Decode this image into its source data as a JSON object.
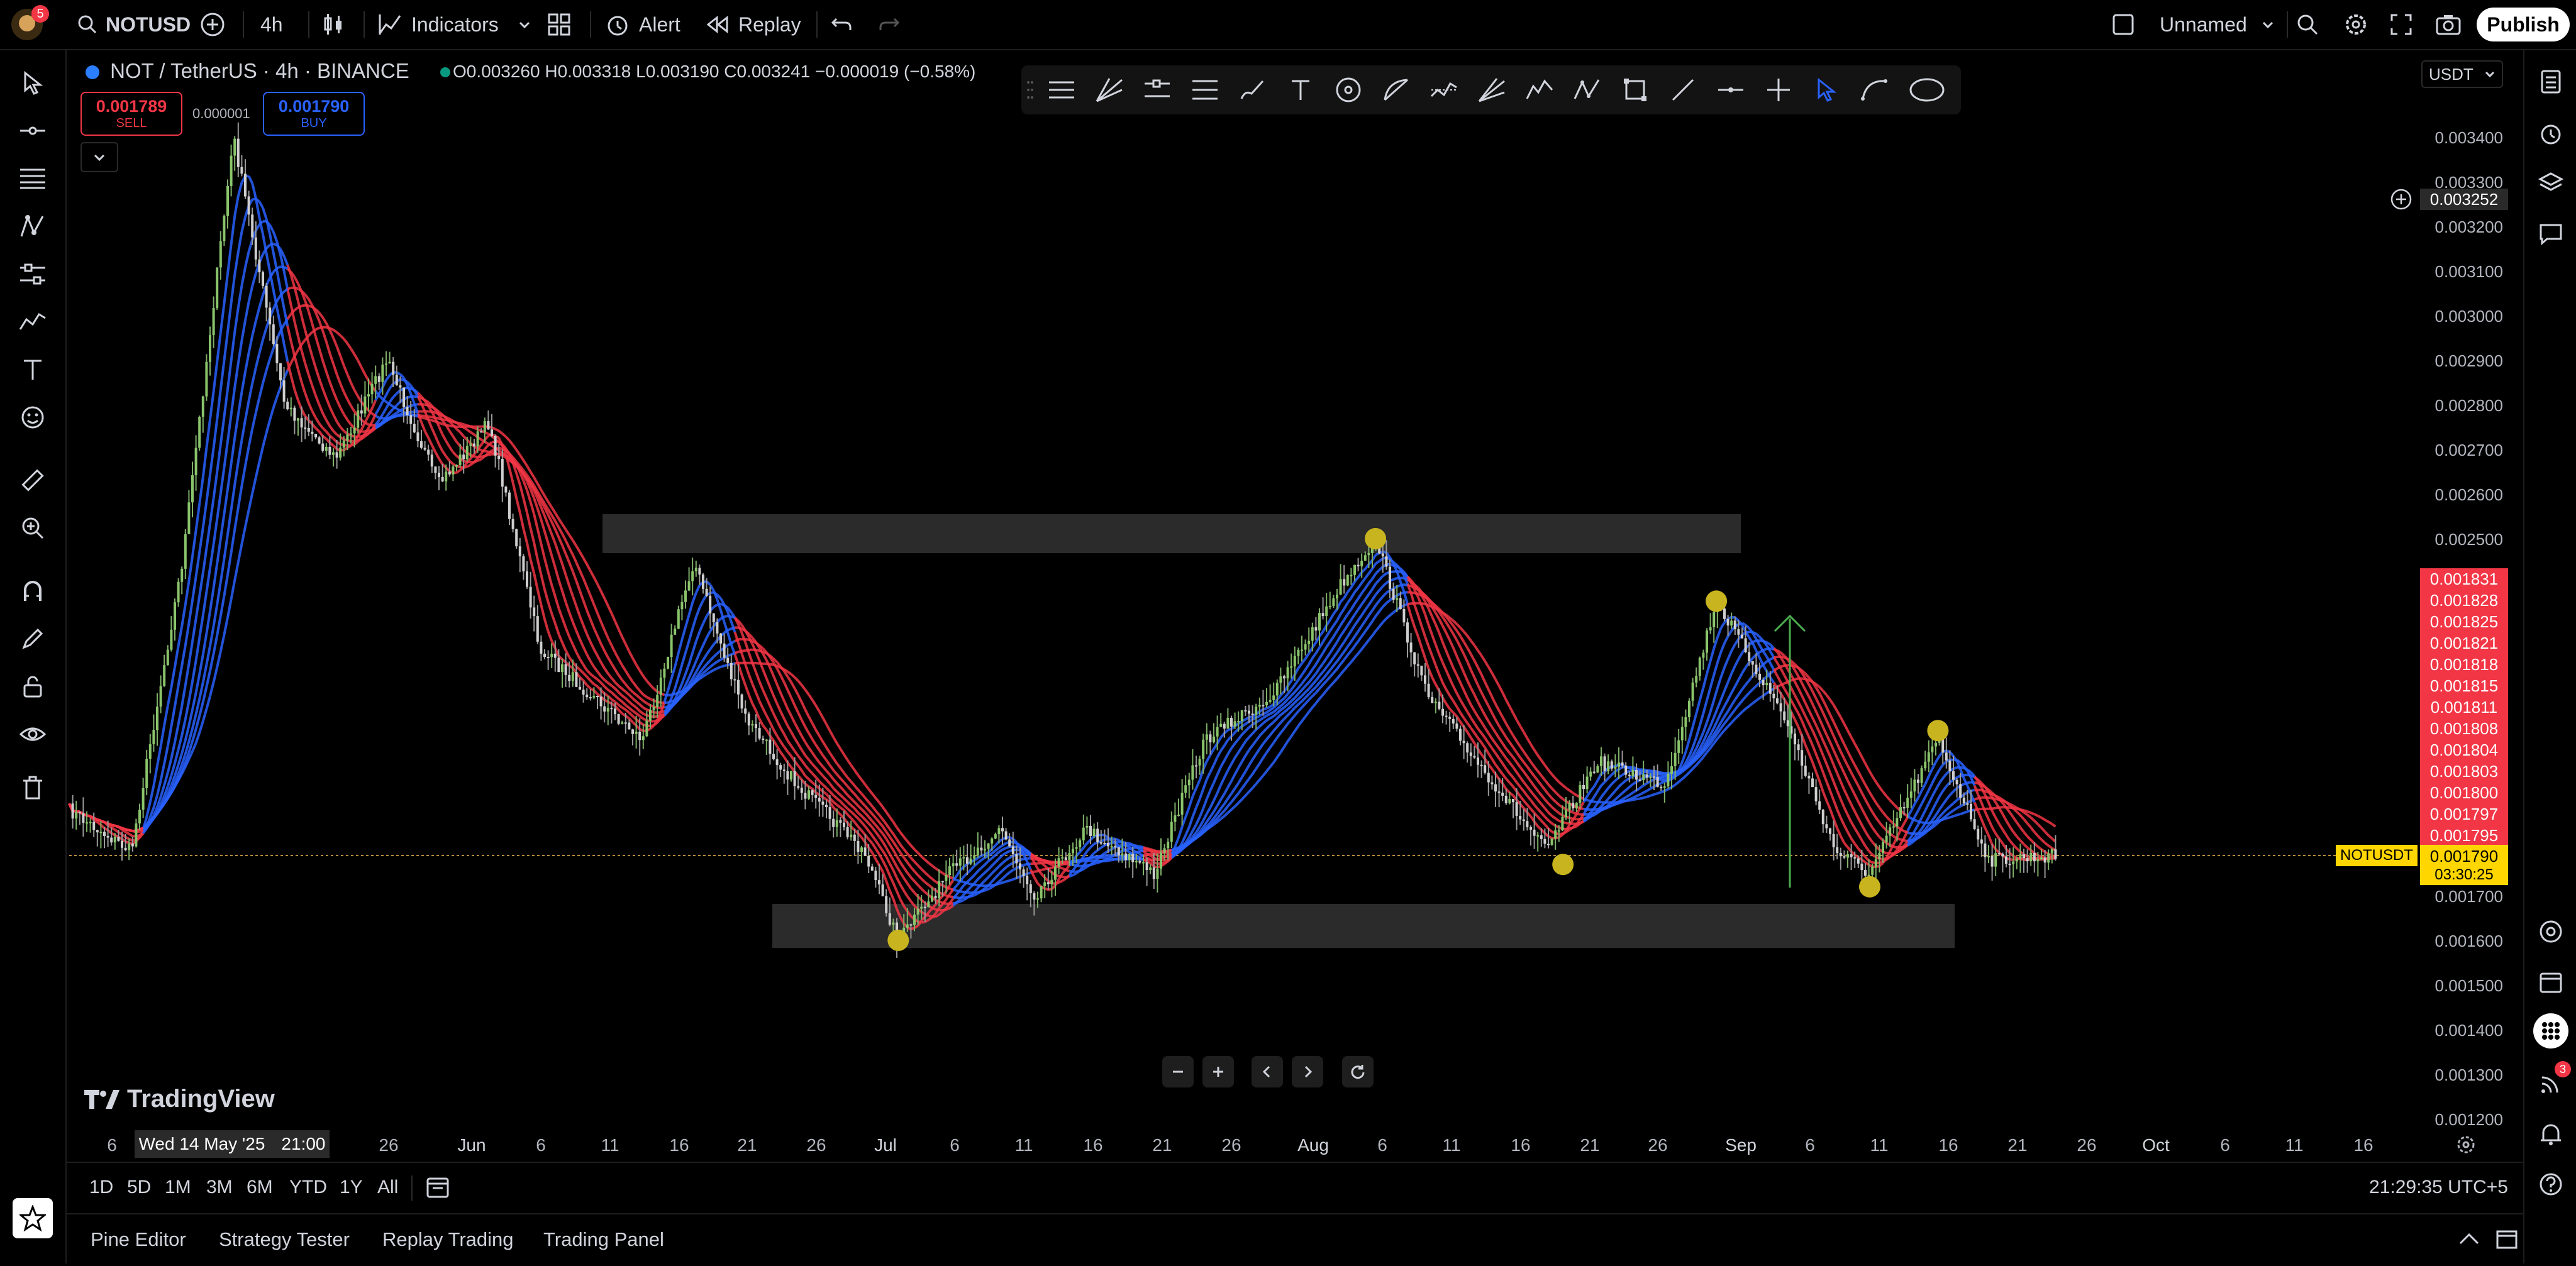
{
  "topbar": {
    "avatar_badge": "5",
    "symbol": "NOTUSD",
    "interval": "4h",
    "indicators_label": "Indicators",
    "alert_label": "Alert",
    "replay_label": "Replay",
    "layout_name": "Unnamed",
    "publish_label": "Publish"
  },
  "legend": {
    "title": "NOT / TetherUS · 4h · BINANCE",
    "ohlc": "O0.003260 H0.003318 L0.003190 C0.003241 −0.000019 (−0.58%)",
    "sell_price": "0.001789",
    "sell_label": "SELL",
    "spread": "0.000001",
    "buy_price": "0.001790",
    "buy_label": "BUY"
  },
  "price_axis": {
    "currency": "USDT",
    "crosshair_price": "0.003252",
    "ticks": [
      "0.003400",
      "0.003300",
      "0.003200",
      "0.003100",
      "0.003000",
      "0.002900",
      "0.002800",
      "0.002700",
      "0.002600",
      "0.002500",
      "0.001700",
      "0.001600",
      "0.001500",
      "0.001400",
      "0.001300",
      "0.001200"
    ],
    "ribbon_labels": [
      "0.001831",
      "0.001828",
      "0.001825",
      "0.001821",
      "0.001818",
      "0.001815",
      "0.001811",
      "0.001808",
      "0.001804",
      "0.001803",
      "0.001800",
      "0.001797",
      "0.001795"
    ],
    "symbol_tag": "NOTUSDT",
    "last_price": "0.001790",
    "countdown": "03:30:25"
  },
  "time_axis": {
    "crosshair_date": "Wed 14 May '25",
    "crosshair_time": "21:00",
    "labels": [
      "6",
      "26",
      "Jun",
      "6",
      "11",
      "16",
      "21",
      "26",
      "Jul",
      "6",
      "11",
      "16",
      "21",
      "26",
      "Aug",
      "6",
      "11",
      "16",
      "21",
      "26",
      "Sep",
      "6",
      "11",
      "16",
      "21",
      "26",
      "Oct",
      "6",
      "11",
      "16"
    ]
  },
  "watermark": "TradingView",
  "ranges": [
    "1D",
    "5D",
    "1M",
    "3M",
    "6M",
    "YTD",
    "1Y",
    "All"
  ],
  "clock": "21:29:35 UTC+5",
  "panels": [
    "Pine Editor",
    "Strategy Tester",
    "Replay Trading",
    "Trading Panel"
  ],
  "right_badges": {
    "ideas": "3"
  },
  "colors": {
    "bull": "#2962ff",
    "bear": "#f23645",
    "marker": "#c8b41e",
    "arrow": "#4caf50",
    "last_price": "#ffd600"
  },
  "chart_data": {
    "type": "candlestick",
    "symbol": "NOT / TetherUS",
    "interval": "4h",
    "exchange": "BINANCE",
    "ylim": [
      0.00115,
      0.00345
    ],
    "resistance_zone": [
      0.00247,
      0.00255
    ],
    "support_zone": [
      0.00158,
      0.00168
    ],
    "price_path": [
      {
        "date": "2025-05-02",
        "price": 0.00212
      },
      {
        "date": "2025-05-05",
        "price": 0.0019
      },
      {
        "date": "2025-05-09",
        "price": 0.0018
      },
      {
        "date": "2025-05-12",
        "price": 0.00245
      },
      {
        "date": "2025-05-15",
        "price": 0.0034
      },
      {
        "date": "2025-05-18",
        "price": 0.0028
      },
      {
        "date": "2025-05-21",
        "price": 0.00268
      },
      {
        "date": "2025-05-24",
        "price": 0.0029
      },
      {
        "date": "2025-05-27",
        "price": 0.00262
      },
      {
        "date": "2025-05-30",
        "price": 0.00276
      },
      {
        "date": "2025-06-02",
        "price": 0.00225
      },
      {
        "date": "2025-06-05",
        "price": 0.00215
      },
      {
        "date": "2025-06-08",
        "price": 0.00205
      },
      {
        "date": "2025-06-11",
        "price": 0.00245
      },
      {
        "date": "2025-06-14",
        "price": 0.0021
      },
      {
        "date": "2025-06-17",
        "price": 0.00195
      },
      {
        "date": "2025-06-21",
        "price": 0.0018
      },
      {
        "date": "2025-06-23",
        "price": 0.0016
      },
      {
        "date": "2025-06-26",
        "price": 0.00175
      },
      {
        "date": "2025-06-29",
        "price": 0.00185
      },
      {
        "date": "2025-07-01",
        "price": 0.0017
      },
      {
        "date": "2025-07-04",
        "price": 0.00185
      },
      {
        "date": "2025-07-08",
        "price": 0.00175
      },
      {
        "date": "2025-07-11",
        "price": 0.00205
      },
      {
        "date": "2025-07-15",
        "price": 0.00215
      },
      {
        "date": "2025-07-19",
        "price": 0.0024
      },
      {
        "date": "2025-07-21",
        "price": 0.0025
      },
      {
        "date": "2025-07-24",
        "price": 0.00215
      },
      {
        "date": "2025-07-28",
        "price": 0.00195
      },
      {
        "date": "2025-07-31",
        "price": 0.0018
      },
      {
        "date": "2025-08-03",
        "price": 0.002
      },
      {
        "date": "2025-08-07",
        "price": 0.00195
      },
      {
        "date": "2025-08-10",
        "price": 0.00236
      },
      {
        "date": "2025-08-14",
        "price": 0.0021
      },
      {
        "date": "2025-08-17",
        "price": 0.0018
      },
      {
        "date": "2025-08-19",
        "price": 0.00175
      },
      {
        "date": "2025-08-23",
        "price": 0.00205
      },
      {
        "date": "2025-08-26",
        "price": 0.00178
      },
      {
        "date": "2025-08-30",
        "price": 0.00179
      }
    ],
    "markers": [
      {
        "date": "2025-06-23",
        "price": 0.0016
      },
      {
        "date": "2025-07-21",
        "price": 0.0025
      },
      {
        "date": "2025-08-01",
        "price": 0.00177
      },
      {
        "date": "2025-08-10",
        "price": 0.00236
      },
      {
        "date": "2025-08-19",
        "price": 0.00172
      },
      {
        "date": "2025-08-23",
        "price": 0.00207
      }
    ],
    "projection_arrow": {
      "date": "2025-09-04",
      "from": 0.0017,
      "to": 0.00225
    }
  }
}
